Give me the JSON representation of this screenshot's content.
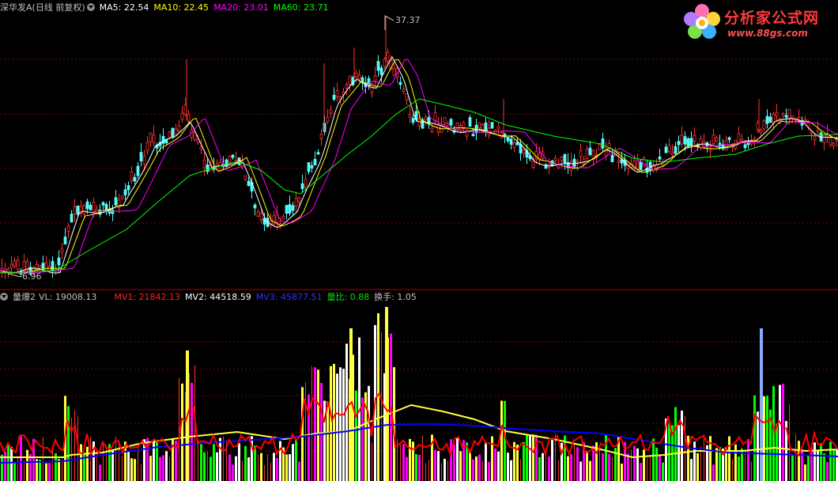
{
  "price_header": {
    "stock": "深华发A",
    "period": "(日线 前复权)",
    "ma5": "MA5: 22.54",
    "ma10": "MA10: 22.45",
    "ma20": "MA20: 23.01",
    "ma60": "MA60: 23.71"
  },
  "price_chart": {
    "high_label": "37.37",
    "low_label": "6.96"
  },
  "volume_header": {
    "indicator": "量爆2",
    "vl": "VL: 19008.13",
    "mv1": "MV1: 21842.13",
    "mv2": "MV2: 44518.59",
    "mv3": "MV3: 45877.51",
    "ratio": "量比: 0.88",
    "turnover": "换手: 1.05"
  },
  "logo": {
    "title": "分析家公式网",
    "url": "www.88gs.com"
  },
  "colors": {
    "up": "#ff3232",
    "down": "#54fcfc",
    "ma5": "#ffffff",
    "ma10": "#ffff00",
    "ma20": "#ff00ff",
    "ma60": "#00ff00",
    "mv1": "#ff0000",
    "mv2": "#ffff40",
    "mv3": "#0000ff",
    "grid": "#8b0000"
  }
}
